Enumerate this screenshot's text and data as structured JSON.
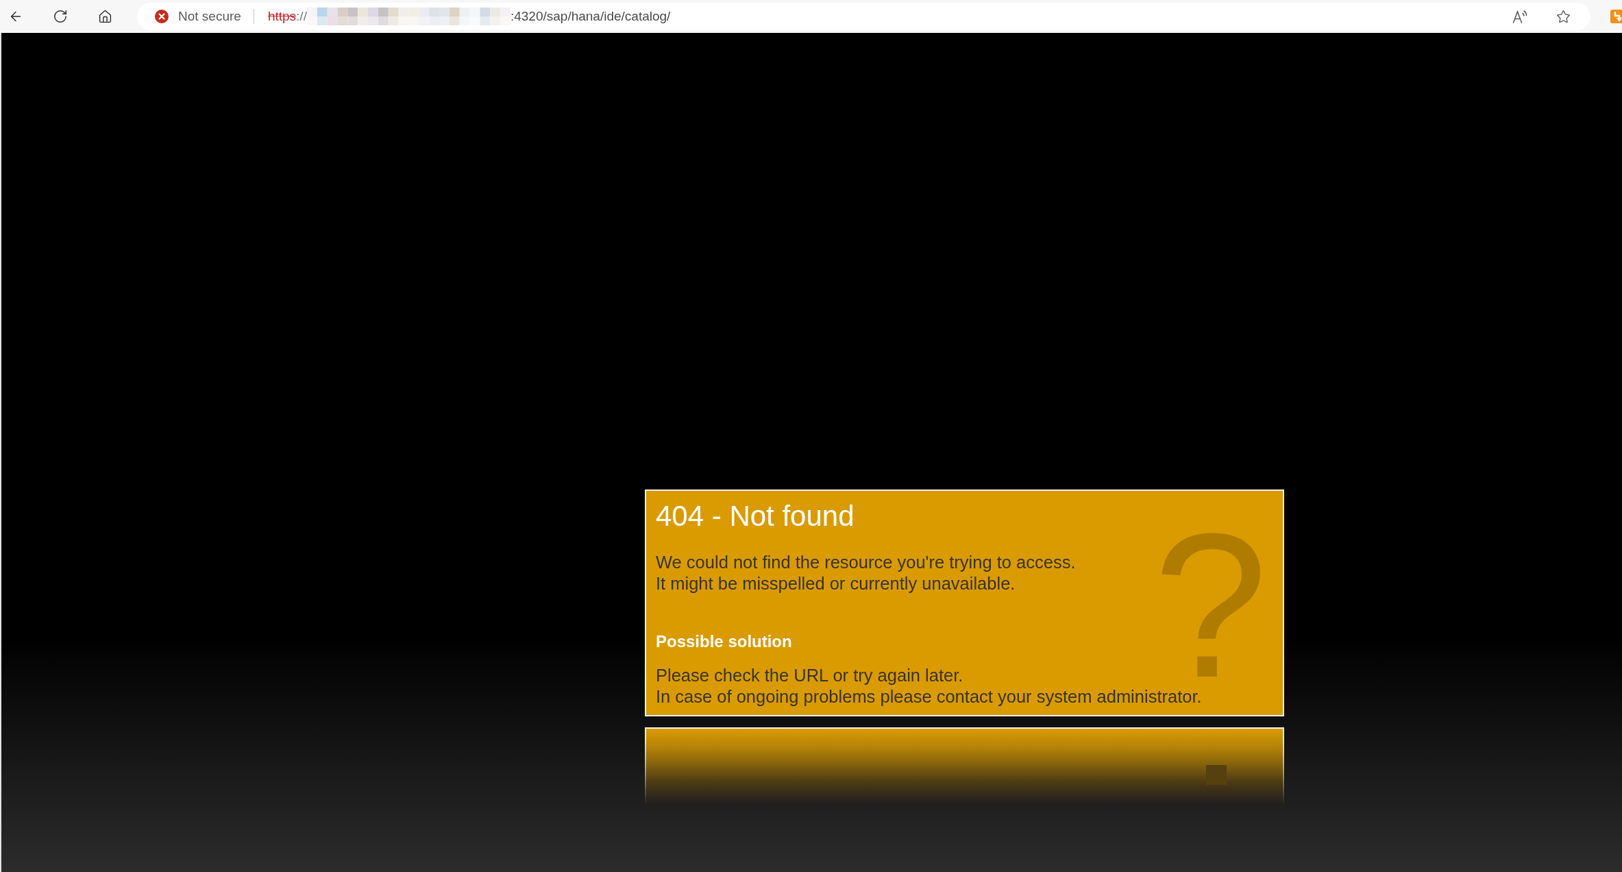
{
  "browser": {
    "security_label": "Not secure",
    "url_scheme": "https",
    "url_separator": "://",
    "url_path": ":4320/sap/hana/ide/catalog/"
  },
  "error_card": {
    "title": "404 - Not found",
    "message_lines": [
      "We could not find the resource you're trying to access.",
      "It might be misspelled or currently unavailable."
    ],
    "solution_heading": "Possible solution",
    "solution_lines": [
      "Please check the URL or try again later.",
      "In case of ongoing problems please contact your system administrator."
    ],
    "symbol": "?"
  }
}
